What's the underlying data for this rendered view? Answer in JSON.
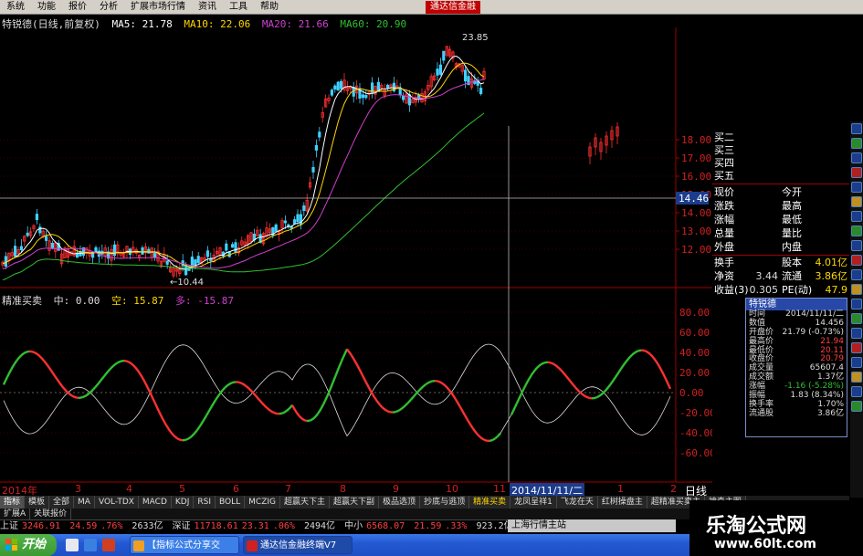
{
  "menu": {
    "items": [
      "系统",
      "功能",
      "报价",
      "分析",
      "扩展市场行情",
      "资讯",
      "工具",
      "帮助"
    ],
    "brand": "通达信金融"
  },
  "price_info": {
    "stock": "特锐德(日线,前复权)",
    "ma5": "MA5: 21.78",
    "ma10": "MA10: 22.06",
    "ma20": "MA20: 21.66",
    "ma60": "MA60: 20.90",
    "high_label": "23.85",
    "low_label": "←10.44"
  },
  "indicator_info": {
    "name": "精准买卖",
    "mid": "中: 0.00",
    "short": "空: 15.87",
    "long": "多: -15.87"
  },
  "price_axis": {
    "ticks": [
      "18.00",
      "17.00",
      "16.00",
      "15.00",
      "14.00",
      "13.00",
      "12.00"
    ],
    "cursor": "14.46"
  },
  "ind_axis": {
    "ticks": [
      "80.00",
      "60.00",
      "40.00",
      "20.00",
      "0.00",
      "-20.00",
      "-40.00",
      "-60.00"
    ]
  },
  "quote": {
    "buy_rows": [
      "买二",
      "买三",
      "买四",
      "买五"
    ],
    "rows": [
      {
        "k": "现价",
        "v": "",
        "k2": "今开",
        "v2": ""
      },
      {
        "k": "涨跌",
        "v": "",
        "k2": "最高",
        "v2": ""
      },
      {
        "k": "涨幅",
        "v": "",
        "k2": "最低",
        "v2": ""
      },
      {
        "k": "总量",
        "v": "",
        "k2": "量比",
        "v2": ""
      },
      {
        "k": "外盘",
        "v": "",
        "k2": "内盘",
        "v2": ""
      }
    ],
    "rows2": [
      {
        "k": "换手",
        "v": "",
        "k2": "股本",
        "v2": "4.01亿"
      },
      {
        "k": "净资",
        "v": "3.44",
        "k2": "流通",
        "v2": "3.86亿"
      },
      {
        "k": "收益(3)",
        "v": "0.305",
        "k2": "PE(动)",
        "v2": "47.9"
      }
    ]
  },
  "popup": {
    "title": "特锐德",
    "rows": [
      {
        "k": "时间",
        "v": "2014/11/11/二"
      },
      {
        "k": "数值",
        "v": "14.456"
      },
      {
        "k": "开盘价",
        "v": "21.79 (-0.73%)"
      },
      {
        "k": "最高价",
        "v": "21.94"
      },
      {
        "k": "最低价",
        "v": "20.11"
      },
      {
        "k": "收盘价",
        "v": "20.79"
      },
      {
        "k": "成交量",
        "v": "65607.4"
      },
      {
        "k": "成交额",
        "v": "1.37亿"
      },
      {
        "k": "涨幅",
        "v": "-1.16 (-5.28%)"
      },
      {
        "k": "振幅",
        "v": "1.83 (8.34%)"
      },
      {
        "k": "换手率",
        "v": "1.70%"
      },
      {
        "k": "流通股",
        "v": "3.86亿"
      }
    ]
  },
  "x_axis": {
    "labels": [
      "2014年",
      "3",
      "4",
      "5",
      "6",
      "7",
      "8",
      "9",
      "10",
      "11",
      "1",
      "2"
    ],
    "cursor_date": "2014/11/11/二",
    "period": "日线"
  },
  "tabs": [
    "指标",
    "模板",
    "全部",
    "MA",
    "VOL-TDX",
    "MACD",
    "KDJ",
    "RSI",
    "BOLL",
    "MCZIG",
    "超赢天下主",
    "超赢天下副",
    "极品选顶",
    "抄底与逃顶",
    "精准买卖",
    "龙凤呈祥1",
    "飞龙在天",
    "红树操盘主",
    "超精准买卖主",
    "神奇主图"
  ],
  "subtabs": [
    "扩展A",
    "关联报价"
  ],
  "status": {
    "sh_label": "上证",
    "sh_value": "3246.91",
    "sh_change": "24.59",
    "sh_pct": ".76%",
    "sh_vol": "2633亿",
    "sz_label": "深证",
    "sz_value": "11718.61",
    "sz_change": "23.31",
    "sz_pct": ".06%",
    "sz_vol": "2494亿",
    "zx_label": "中小",
    "zx_value": "6568.07",
    "zx_change": "21.59",
    "zx_pct": ".33%",
    "zx_vol": "923.2亿",
    "feed": "上海行情主站"
  },
  "taskbar": {
    "start": "开始",
    "task1": "【指标公式分享交",
    "task2": "通达信金融终端V7"
  },
  "watermark": {
    "line1": "乐淘公式网",
    "line2": "www.60lt.com"
  },
  "colors": {
    "up": "#ff3030",
    "down": "#30c030",
    "ma5": "#ffffff",
    "ma10": "#ffd700",
    "ma20": "#d040d0",
    "ma60": "#30c030",
    "grid": "#a00000"
  }
}
